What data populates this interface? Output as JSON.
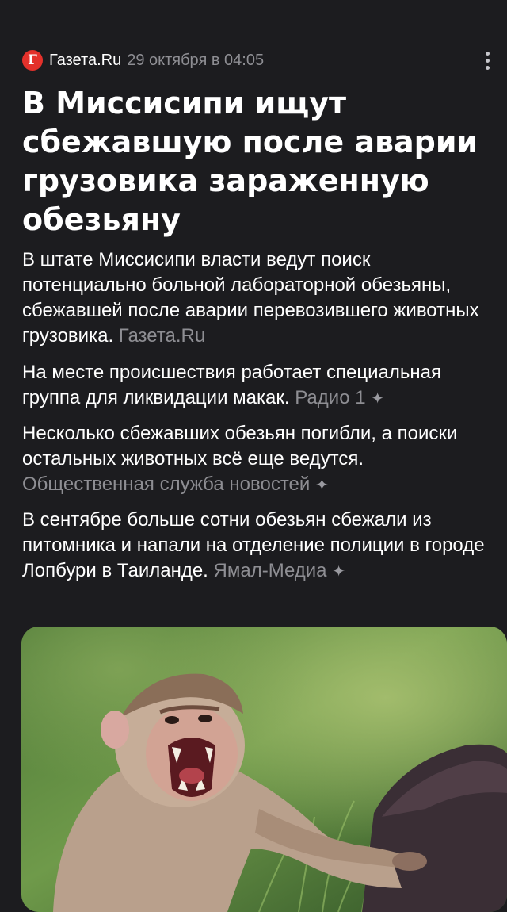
{
  "source": {
    "logo_letter": "Г",
    "name": "Газета.Ru",
    "date": "29 октября в 04:05"
  },
  "menu": {
    "icon": "more-vertical-icon"
  },
  "headline": "В Миссисипи ищут сбежавшую после аварии грузовика зараженную обезьяну",
  "paragraphs": [
    {
      "text": "В штате Миссисипи власти ведут поиск потенциально больной лабораторной обезьяны, сбежавшей после аварии перевозившего животных грузовика.",
      "source": "Газета.Ru",
      "ai_icon": ""
    },
    {
      "text": "На месте происшествия работает специальная группа для ликвидации макак.",
      "source": "Радио 1",
      "ai_icon": "✦"
    },
    {
      "text": "Несколько сбежавших обезьян погибли, а поиски остальных животных всё еще ведутся.",
      "source": "Общественная служба новостей",
      "ai_icon": "✦"
    },
    {
      "text": "В сентябре больше сотни обезьян сбежали из питомника и напали на отделение полиции в городе Лопбури в Таиланде.",
      "source": "Ямал-Медиа",
      "ai_icon": "✦"
    }
  ],
  "colors": {
    "background": "#1c1c1f",
    "text": "#ffffff",
    "muted": "#8e8e93",
    "logo": "#e4312b"
  }
}
